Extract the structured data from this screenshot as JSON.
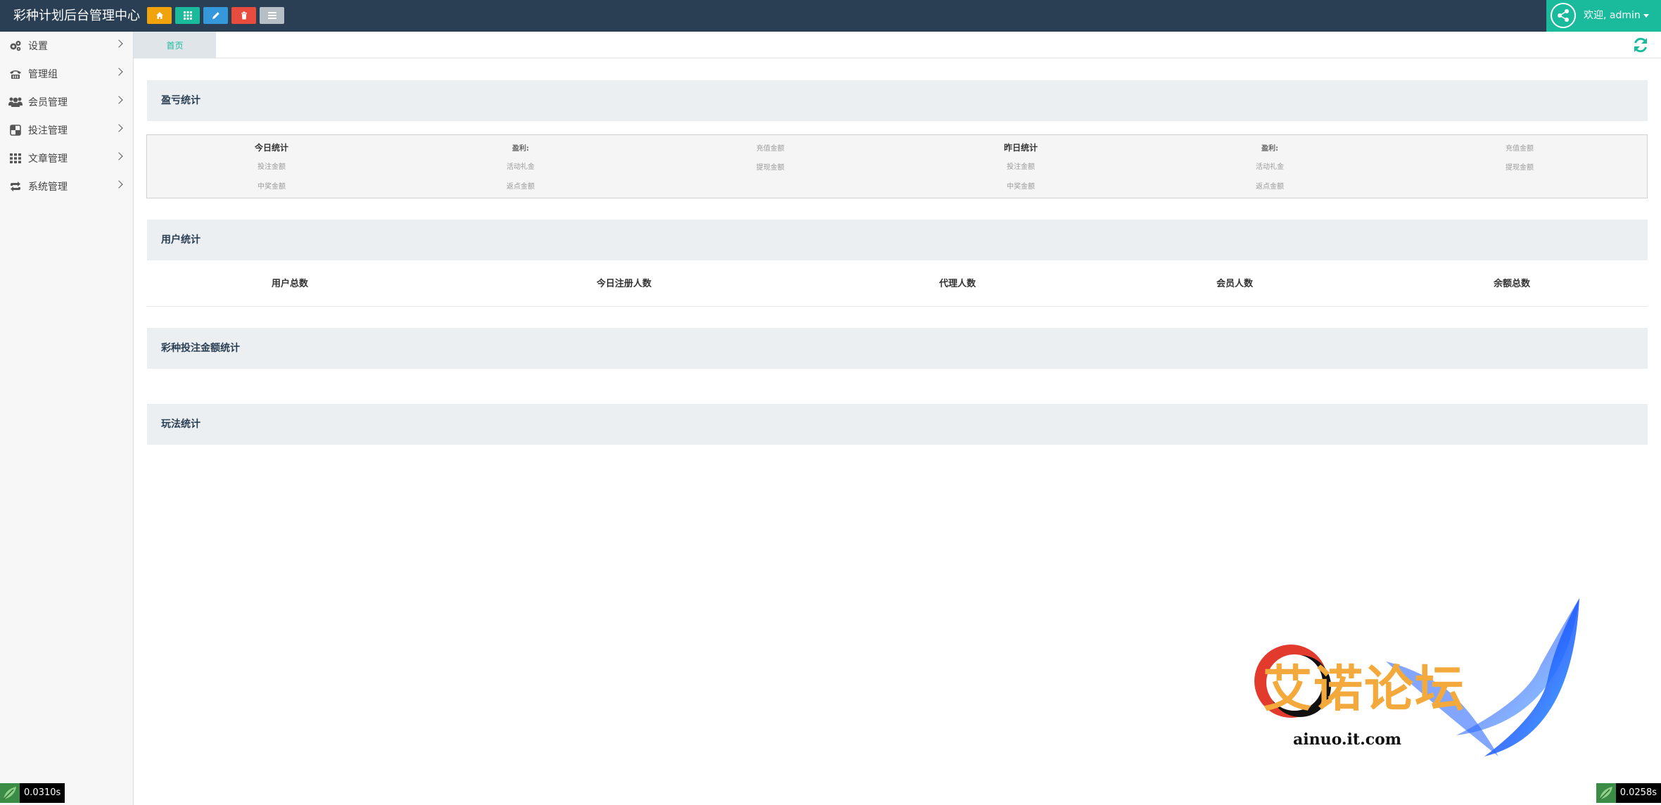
{
  "app": {
    "title": "彩种计划后台管理中心",
    "toolbar_buttons": [
      {
        "icon": "home-icon",
        "color": "#f0a30a"
      },
      {
        "icon": "grid-icon",
        "color": "#1abb9c"
      },
      {
        "icon": "pencil-icon",
        "color": "#3498db"
      },
      {
        "icon": "trash-icon",
        "color": "#e74c3c"
      },
      {
        "icon": "list-icon",
        "color": "#b6bec6"
      }
    ],
    "user": {
      "greeting": "欢迎, admin",
      "avatar_icon": "share-node-icon",
      "color": "#1abb9c"
    }
  },
  "sidebar": {
    "items": [
      {
        "label": "设置",
        "icon": "cogs-icon"
      },
      {
        "label": "管理组",
        "icon": "phone-icon"
      },
      {
        "label": "会员管理",
        "icon": "users-icon"
      },
      {
        "label": "投注管理",
        "icon": "squares-icon"
      },
      {
        "label": "文章管理",
        "icon": "grid-icon"
      },
      {
        "label": "系统管理",
        "icon": "exchange-icon"
      }
    ]
  },
  "tabs": {
    "home": "首页",
    "refresh_icon": "refresh-icon"
  },
  "profit": {
    "title": "盈亏统计",
    "today": {
      "title": "今日统计",
      "profit": "盈利:",
      "recharge": "充值金额",
      "bet": "投注金额",
      "activity": "活动礼金",
      "withdraw": "提现金额",
      "win": "中奖金额",
      "rebate": "返点金额"
    },
    "yesterday": {
      "title": "昨日统计",
      "profit": "盈利:",
      "recharge": "充值金额",
      "bet": "投注金额",
      "activity": "活动礼金",
      "withdraw": "提现金额",
      "win": "中奖金额",
      "rebate": "返点金额"
    }
  },
  "users": {
    "title": "用户统计",
    "columns": [
      "用户总数",
      "今日注册人数",
      "代理人数",
      "会员人数",
      "余额总数"
    ]
  },
  "lottery_bets": {
    "title": "彩种投注金额统计"
  },
  "plays": {
    "title": "玩法统计"
  },
  "timers": {
    "left": "0.0310s",
    "right": "0.0258s"
  },
  "watermark": {
    "name": "艾诺论坛",
    "url": "ainuo.it.com"
  }
}
